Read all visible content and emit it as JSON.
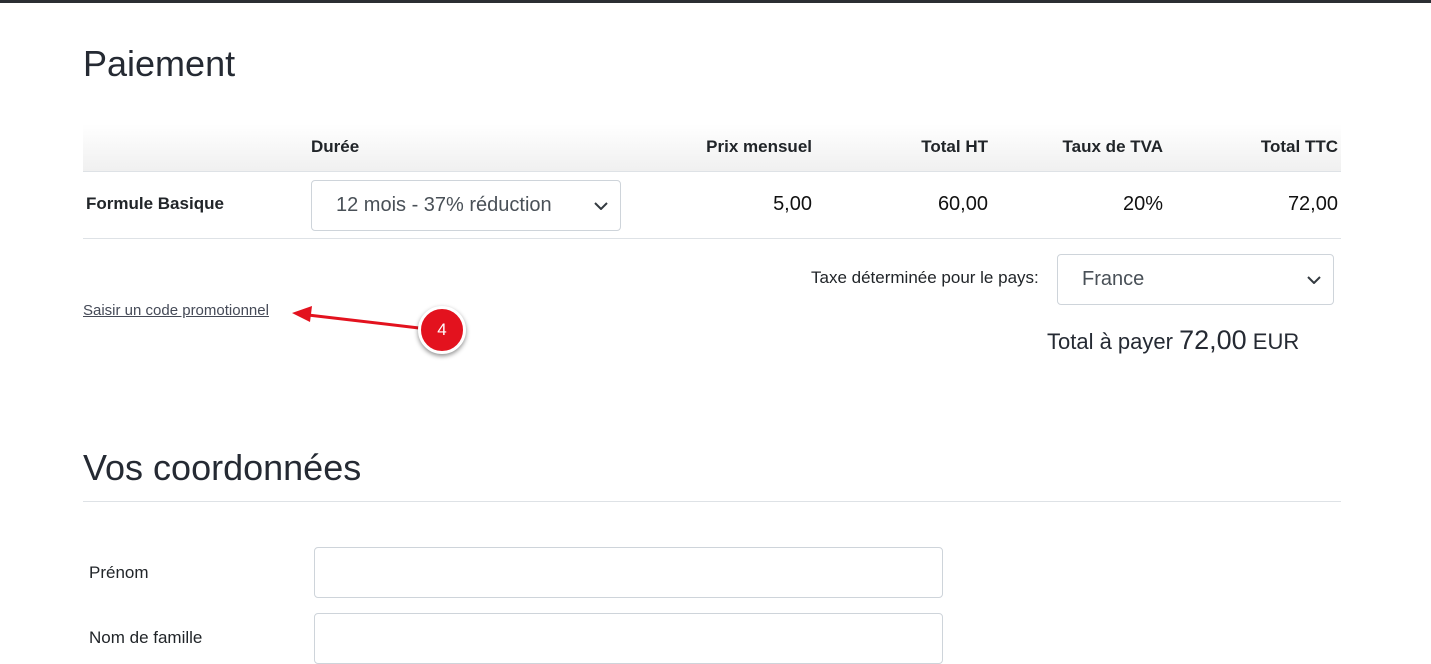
{
  "payment": {
    "title": "Paiement",
    "table": {
      "headers": {
        "duration": "Durée",
        "monthly_price": "Prix mensuel",
        "total_ht": "Total HT",
        "vat_rate": "Taux de TVA",
        "total_ttc": "Total TTC"
      },
      "row": {
        "plan": "Formule Basique",
        "duration_selected": "12 mois - 37% réduction",
        "monthly_price": "5,00",
        "total_ht": "60,00",
        "vat_rate": "20%",
        "total_ttc": "72,00"
      }
    },
    "tax_country_label": "Taxe déterminée pour le pays:",
    "tax_country_selected": "France",
    "promo_link": "Saisir un code promotionnel",
    "total_label": "Total à payer",
    "total_amount": "72,00",
    "total_currency": "EUR"
  },
  "annotation": {
    "step_number": "4",
    "color": "#e3121e"
  },
  "contact": {
    "title": "Vos coordonnées",
    "fields": {
      "first_name_label": "Prénom",
      "last_name_label": "Nom de famille"
    }
  }
}
